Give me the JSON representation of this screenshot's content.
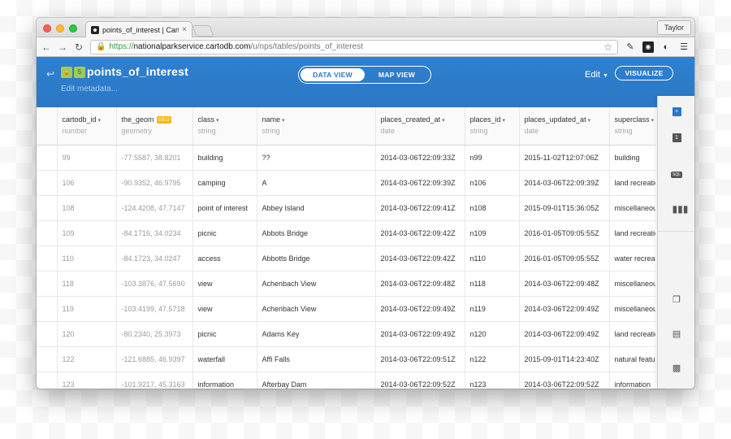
{
  "browser": {
    "tab_title": "points_of_interest | CartoD",
    "tab_close": "×",
    "profile": "Taylor",
    "url_scheme": "https://",
    "url_host": "nationalparkservice.cartodb.com",
    "url_path": "/u/nps/tables/points_of_interest"
  },
  "header": {
    "badge_count": "5",
    "table_name": "points_of_interest",
    "edit_metadata": "Edit metadata...",
    "data_view": "DATA VIEW",
    "map_view": "MAP VIEW",
    "edit_menu": "Edit",
    "visualize": "VISUALIZE"
  },
  "columns": [
    {
      "name": "cartodb_id",
      "type": "number"
    },
    {
      "name": "the_geom",
      "type": "geometry",
      "badge": "GEO"
    },
    {
      "name": "class",
      "type": "string"
    },
    {
      "name": "name",
      "type": "string"
    },
    {
      "name": "places_created_at",
      "type": "date"
    },
    {
      "name": "places_id",
      "type": "string"
    },
    {
      "name": "places_updated_at",
      "type": "date"
    },
    {
      "name": "superclass",
      "type": "string"
    }
  ],
  "rows": [
    [
      "99",
      "-77.5587, 38.8201",
      "building",
      "??",
      "2014-03-06T22:09:33Z",
      "n99",
      "2015-11-02T12:07:06Z",
      "building"
    ],
    [
      "106",
      "-90.9352, 46.9795",
      "camping",
      "A",
      "2014-03-06T22:09:39Z",
      "n106",
      "2014-03-06T22:09:39Z",
      "land recreatio"
    ],
    [
      "108",
      "-124.4208, 47.7147",
      "point of interest",
      "Abbey Island",
      "2014-03-06T22:09:41Z",
      "n108",
      "2015-09-01T15:36:05Z",
      "miscellaneous"
    ],
    [
      "109",
      "-84.1716, 34.0234",
      "picnic",
      "Abbots Bridge",
      "2014-03-06T22:09:42Z",
      "n109",
      "2016-01-05T09:05:55Z",
      "land recreatio"
    ],
    [
      "110",
      "-84.1723, 34.0247",
      "access",
      "Abbotts Bridge",
      "2014-03-06T22:09:42Z",
      "n110",
      "2016-01-05T09:05:55Z",
      "water recreati"
    ],
    [
      "118",
      "-103.3876, 47.5690",
      "view",
      "Achenbach View",
      "2014-03-06T22:09:48Z",
      "n118",
      "2014-03-06T22:09:48Z",
      "miscellaneous"
    ],
    [
      "119",
      "-103.4199, 47.5718",
      "view",
      "Achenbach View",
      "2014-03-06T22:09:49Z",
      "n119",
      "2014-03-06T22:09:49Z",
      "miscellaneous"
    ],
    [
      "120",
      "-80.2340, 25.3973",
      "picnic",
      "Adams Key",
      "2014-03-06T22:09:49Z",
      "n120",
      "2014-03-06T22:09:49Z",
      "land recreatio"
    ],
    [
      "122",
      "-121.6885, 46.9397",
      "waterfall",
      "Affi Falls",
      "2014-03-06T22:09:51Z",
      "n122",
      "2015-09-01T14:23:40Z",
      "natural featur"
    ],
    [
      "123",
      "-101.9217, 45.3163",
      "information",
      "Afterbay Dam",
      "2014-03-06T22:09:52Z",
      "n123",
      "2014-03-06T22:09:52Z",
      "information"
    ]
  ],
  "rail": {
    "add_label": "+",
    "layer_label": "1",
    "sql_label": "SQL"
  },
  "icons": [
    "back-icon",
    "lock-icon",
    "star-icon",
    "eyedropper-icon",
    "reload-icon",
    "menu-icon",
    "add-icon",
    "sql-icon",
    "chart-icon",
    "merge-icon",
    "filter-icon",
    "legend-icon"
  ],
  "colors": {
    "header_blue": "#2b78c5",
    "badge_green": "#9ecb59",
    "geo_badge": "#f5b800"
  }
}
